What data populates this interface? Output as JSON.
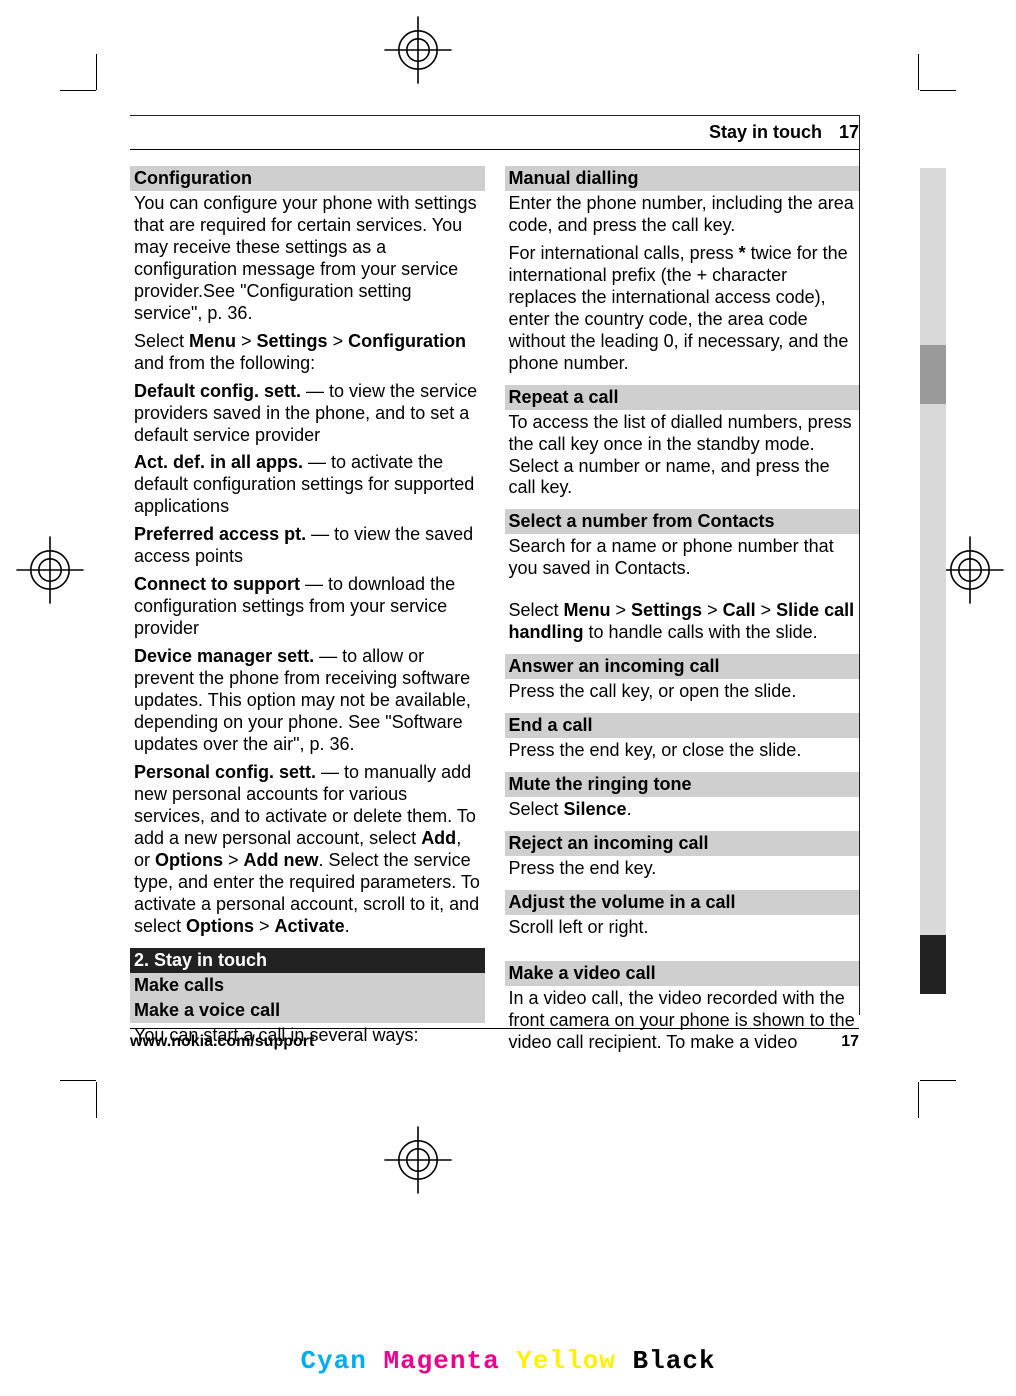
{
  "header": {
    "section": "Stay in touch",
    "page": "17"
  },
  "left": {
    "config_bar": "Configuration",
    "config_p1a": "You can configure your phone with settings that are required for certain services. You may receive these settings as a configuration message from your service provider.See \"Configuration setting service\", p. 36.",
    "select_line_a": "Select ",
    "menu": "Menu",
    "gt1": " > ",
    "settings": "Settings",
    "gt2": " > ",
    "configuration": "Configuration",
    "follow": " and from the following:",
    "i1_b": "Default config. sett.",
    "i1_t": "  — to view the service providers saved in the phone, and to set a default service provider",
    "i2_b": "Act. def. in all apps.",
    "i2_t": "  — to activate the default configuration settings for supported applications",
    "i3_b": "Preferred access pt.",
    "i3_t": "  — to view the saved access points",
    "i4_b": "Connect to support",
    "i4_t": "  — to download the configuration settings from your service provider",
    "i5_b": "Device manager sett.",
    "i5_t": "  — to allow or prevent the phone from receiving software updates. This option may not be available, depending on your phone. See \"Software updates over the air\", p. 36.",
    "i6_b": "Personal config. sett.",
    "i6_t1": "  — to manually add new personal accounts for various services, and to activate or delete them. To add a new personal account, select ",
    "i6_add": "Add",
    "i6_or": ", or ",
    "i6_opt": "Options",
    "i6_gt": " > ",
    "i6_addnew": "Add new",
    "i6_t2": ". Select the service type, and enter the required parameters. To activate a personal account, scroll to it, and select ",
    "i6_opt2": "Options",
    "i6_gt2": " > ",
    "i6_act": "Activate",
    "i6_dot": ".",
    "dark_bar": "2.    Stay in touch",
    "makecalls_bar": "Make calls",
    "makevoice_bar": "Make a voice call",
    "makevoice_p": "You can start a call in several ways:"
  },
  "right": {
    "manual_bar": "Manual dialling",
    "manual_p1": "Enter the phone number, including the area code, and press the call key.",
    "manual_p2a": "For international calls, press ",
    "manual_star": "*",
    "manual_p2b": " twice for the international prefix (the + character replaces the international access code), enter the country code, the area code without the leading 0, if necessary, and the phone number.",
    "repeat_bar": "Repeat a call",
    "repeat_p": "To access the list of dialled numbers, press the call key once in the standby mode. Select a number or name, and press the call key.",
    "selectnum_bar": "Select a number from Contacts",
    "selectnum_p": "Search for a name or phone number that you saved in Contacts.",
    "slide_a": "Select ",
    "slide_menu": "Menu",
    "slide_g1": " > ",
    "slide_set": "Settings",
    "slide_g2": " > ",
    "slide_call": "Call",
    "slide_g3": " > ",
    "slide_sch": "Slide call handling",
    "slide_rest": " to handle calls with the slide.",
    "answer_bar": "Answer an incoming call",
    "answer_p": "Press the call key, or open the slide.",
    "end_bar": "End a call",
    "end_p": "Press the end key, or close the slide.",
    "mute_bar": "Mute the ringing tone",
    "mute_a": "Select ",
    "mute_b": "Silence",
    "mute_c": ".",
    "reject_bar": "Reject an incoming call",
    "reject_p": "Press the end key.",
    "adjust_bar": "Adjust the volume in a call",
    "adjust_p": "Scroll left or right.",
    "video_bar": "Make a video call",
    "video_p": "In a video call, the video recorded with the front camera on your phone is shown to the video call recipient. To make a video"
  },
  "footer": {
    "url": "www.nokia.com/support",
    "page": "17"
  },
  "cmyk": {
    "c": "Cyan",
    "m": "Magenta",
    "y": "Yellow",
    "k": "Black"
  }
}
